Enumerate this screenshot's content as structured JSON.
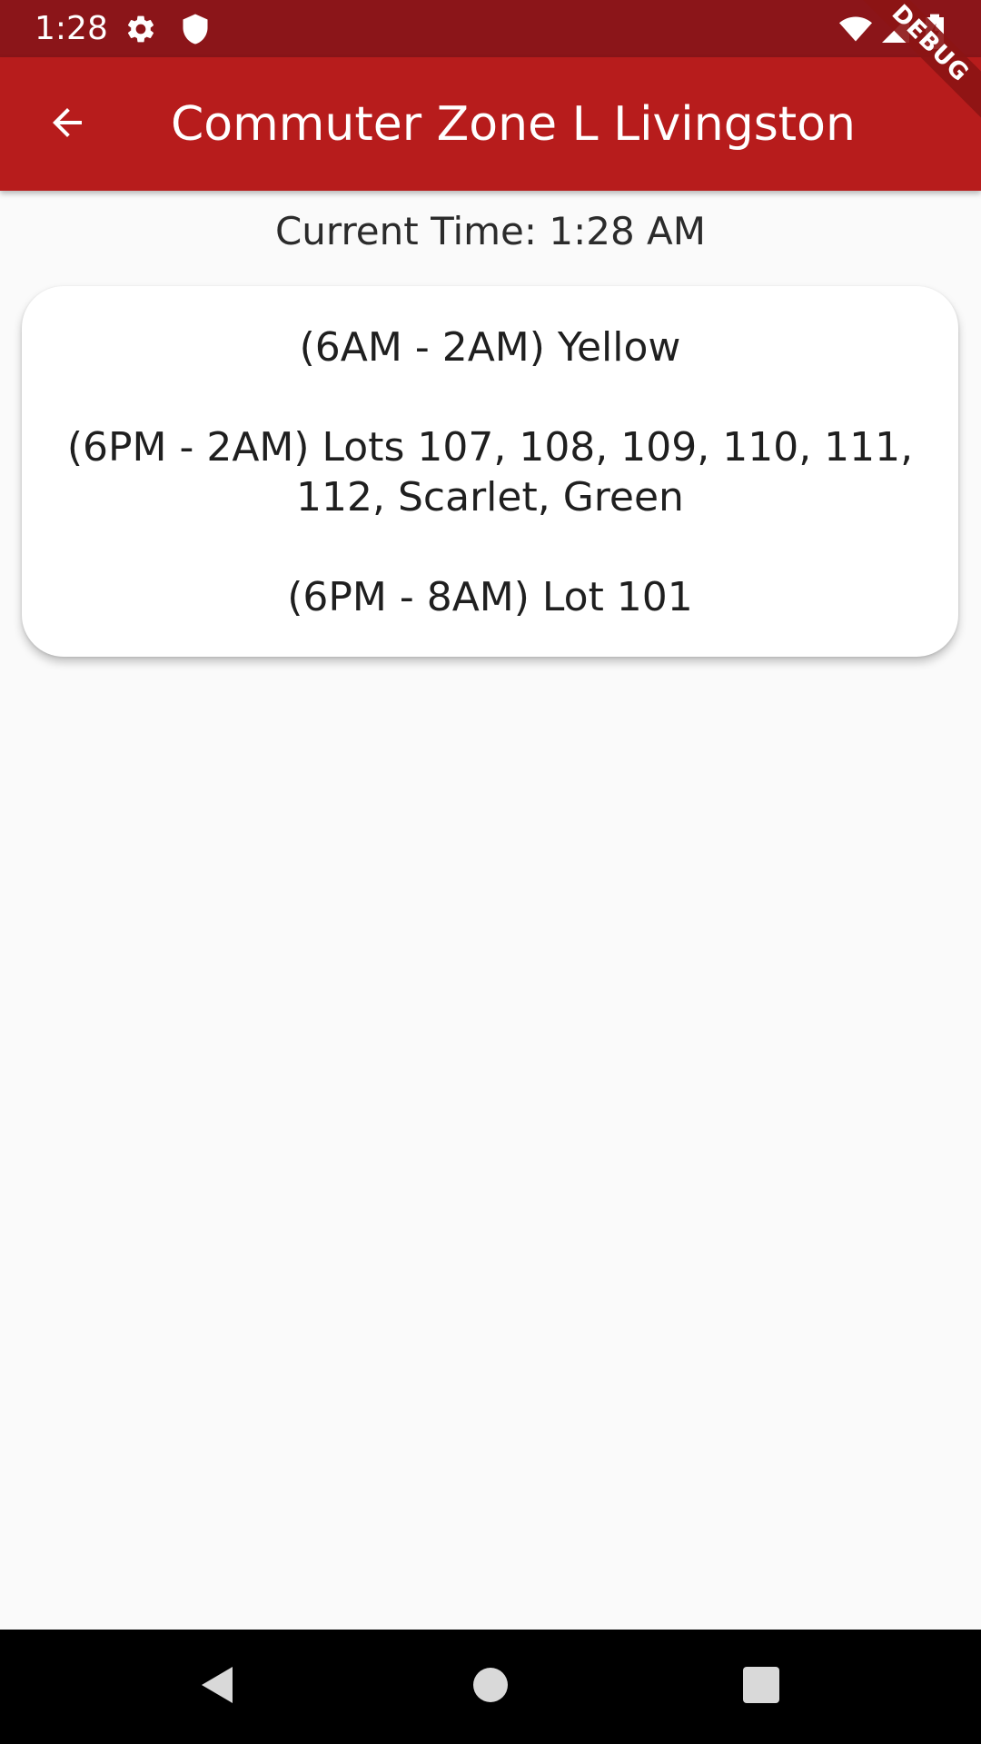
{
  "status_bar": {
    "time": "1:28",
    "icons": [
      "settings-icon",
      "shield-icon",
      "wifi-icon",
      "signal-icon",
      "battery-charging-icon"
    ]
  },
  "app_bar": {
    "title": "Commuter Zone L Livingston",
    "back_icon": "arrow-back-icon",
    "color": "#b71c1c"
  },
  "debug_banner": "DEBUG",
  "current_time": "Current Time: 1:28 AM",
  "schedule": [
    "(6AM - 2AM) Yellow",
    "(6PM - 2AM) Lots 107, 108, 109, 110, 111, 112, Scarlet, Green",
    "(6PM - 8AM) Lot 101"
  ],
  "nav_bar": {
    "icons": [
      "back-triangle-icon",
      "home-circle-icon",
      "recents-square-icon"
    ]
  }
}
